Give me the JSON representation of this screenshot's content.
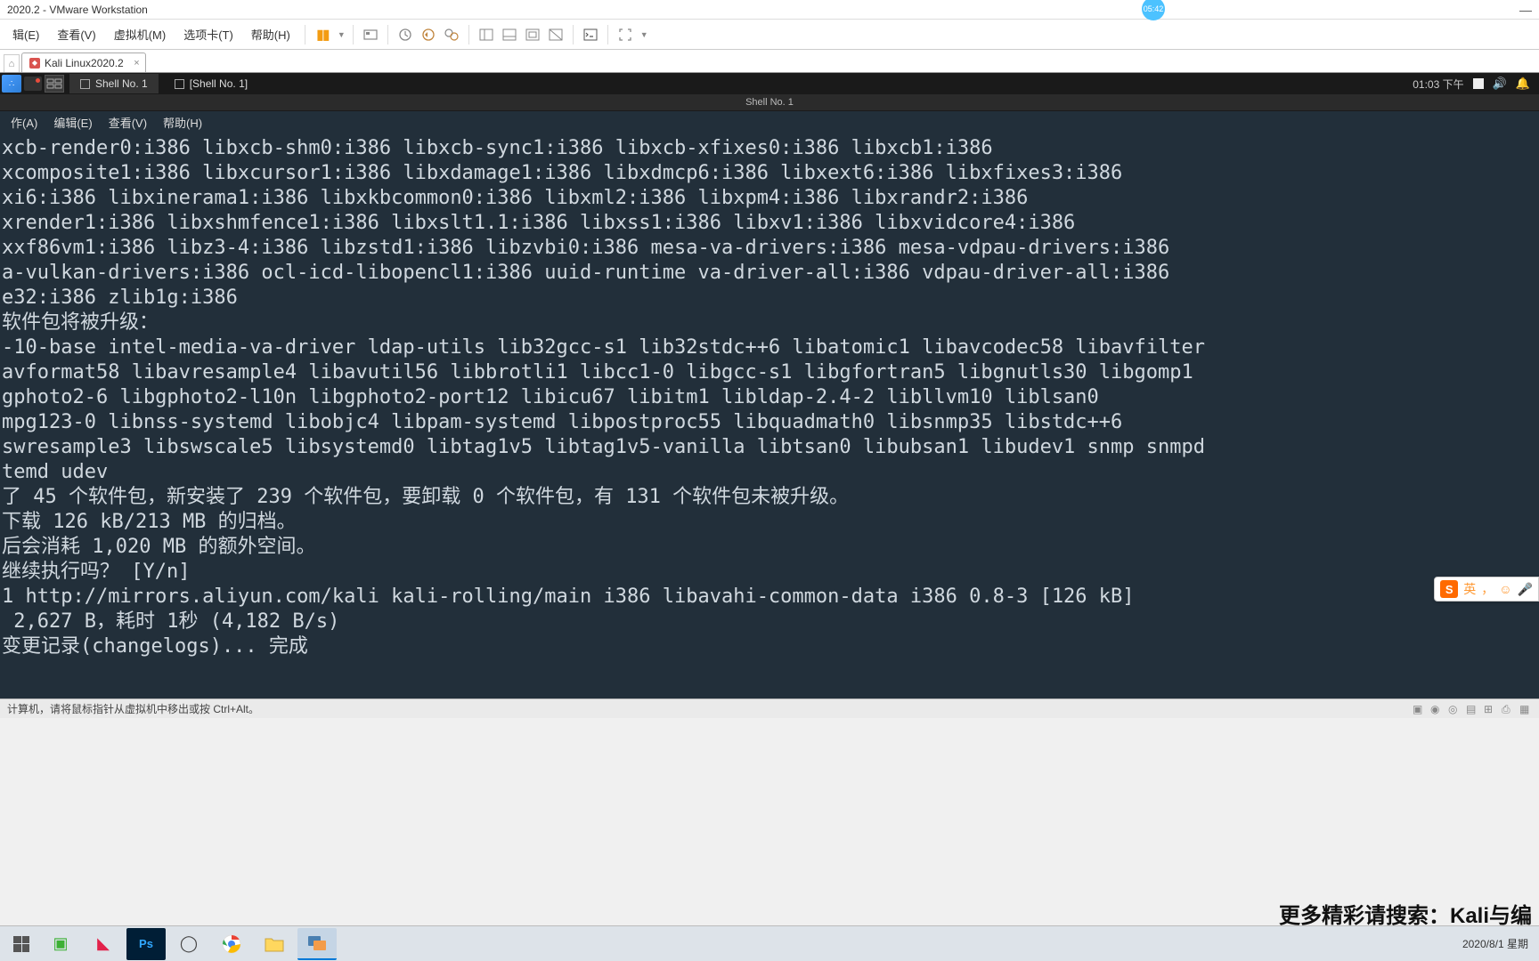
{
  "win": {
    "title": "2020.2 - VMware Workstation",
    "clock_badge": "05:42",
    "minimize": "—"
  },
  "vmmenu": {
    "edit": "辑(E)",
    "view": "查看(V)",
    "vm": "虚拟机(M)",
    "tabs": "选项卡(T)",
    "help": "帮助(H)"
  },
  "vmtab": {
    "name": "Kali Linux2020.2",
    "close": "×"
  },
  "kali_panel": {
    "shell1": "Shell No. 1",
    "shell1_br": "[Shell No. 1]",
    "clock": "01:03 下午"
  },
  "term": {
    "title": "Shell No. 1",
    "menu_file": "作(A)",
    "menu_edit": "编辑(E)",
    "menu_view": "查看(V)",
    "menu_help": "帮助(H)",
    "lines": [
      "xcb-render0:i386 libxcb-shm0:i386 libxcb-sync1:i386 libxcb-xfixes0:i386 libxcb1:i386",
      "xcomposite1:i386 libxcursor1:i386 libxdamage1:i386 libxdmcp6:i386 libxext6:i386 libxfixes3:i386",
      "xi6:i386 libxinerama1:i386 libxkbcommon0:i386 libxml2:i386 libxpm4:i386 libxrandr2:i386",
      "xrender1:i386 libxshmfence1:i386 libxslt1.1:i386 libxss1:i386 libxv1:i386 libxvidcore4:i386",
      "xxf86vm1:i386 libz3-4:i386 libzstd1:i386 libzvbi0:i386 mesa-va-drivers:i386 mesa-vdpau-drivers:i386",
      "a-vulkan-drivers:i386 ocl-icd-libopencl1:i386 uuid-runtime va-driver-all:i386 vdpau-driver-all:i386",
      "e32:i386 zlib1g:i386",
      "软件包将被升级：",
      "-10-base intel-media-va-driver ldap-utils lib32gcc-s1 lib32stdc++6 libatomic1 libavcodec58 libavfilter",
      "avformat58 libavresample4 libavutil56 libbrotli1 libcc1-0 libgcc-s1 libgfortran5 libgnutls30 libgomp1",
      "gphoto2-6 libgphoto2-l10n libgphoto2-port12 libicu67 libitm1 libldap-2.4-2 libllvm10 liblsan0",
      "mpg123-0 libnss-systemd libobjc4 libpam-systemd libpostproc55 libquadmath0 libsnmp35 libstdc++6",
      "swresample3 libswscale5 libsystemd0 libtag1v5 libtag1v5-vanilla libtsan0 libubsan1 libudev1 snmp snmpd",
      "temd udev",
      "了 45 个软件包，新安装了 239 个软件包，要卸载 0 个软件包，有 131 个软件包未被升级。",
      "下载 126 kB/213 MB 的归档。",
      "后会消耗 1,020 MB 的额外空间。",
      "继续执行吗？ [Y/n]",
      "1 http://mirrors.aliyun.com/kali kali-rolling/main i386 libavahi-common-data i386 0.8-3 [126 kB]",
      " 2,627 B，耗时 1秒 (4,182 B/s)",
      "变更记录(changelogs)... 完成"
    ]
  },
  "vm_status": {
    "text": "计算机，请将鼠标指针从虚拟机中移出或按 Ctrl+Alt。"
  },
  "ime": {
    "s": "S",
    "lang": "英",
    "comma": "，",
    "smile": "☺",
    "mic": "🎤"
  },
  "overlay": "更多精彩请搜索：Kali与编",
  "taskbar": {
    "date_time": "2020/8/1 星期"
  }
}
